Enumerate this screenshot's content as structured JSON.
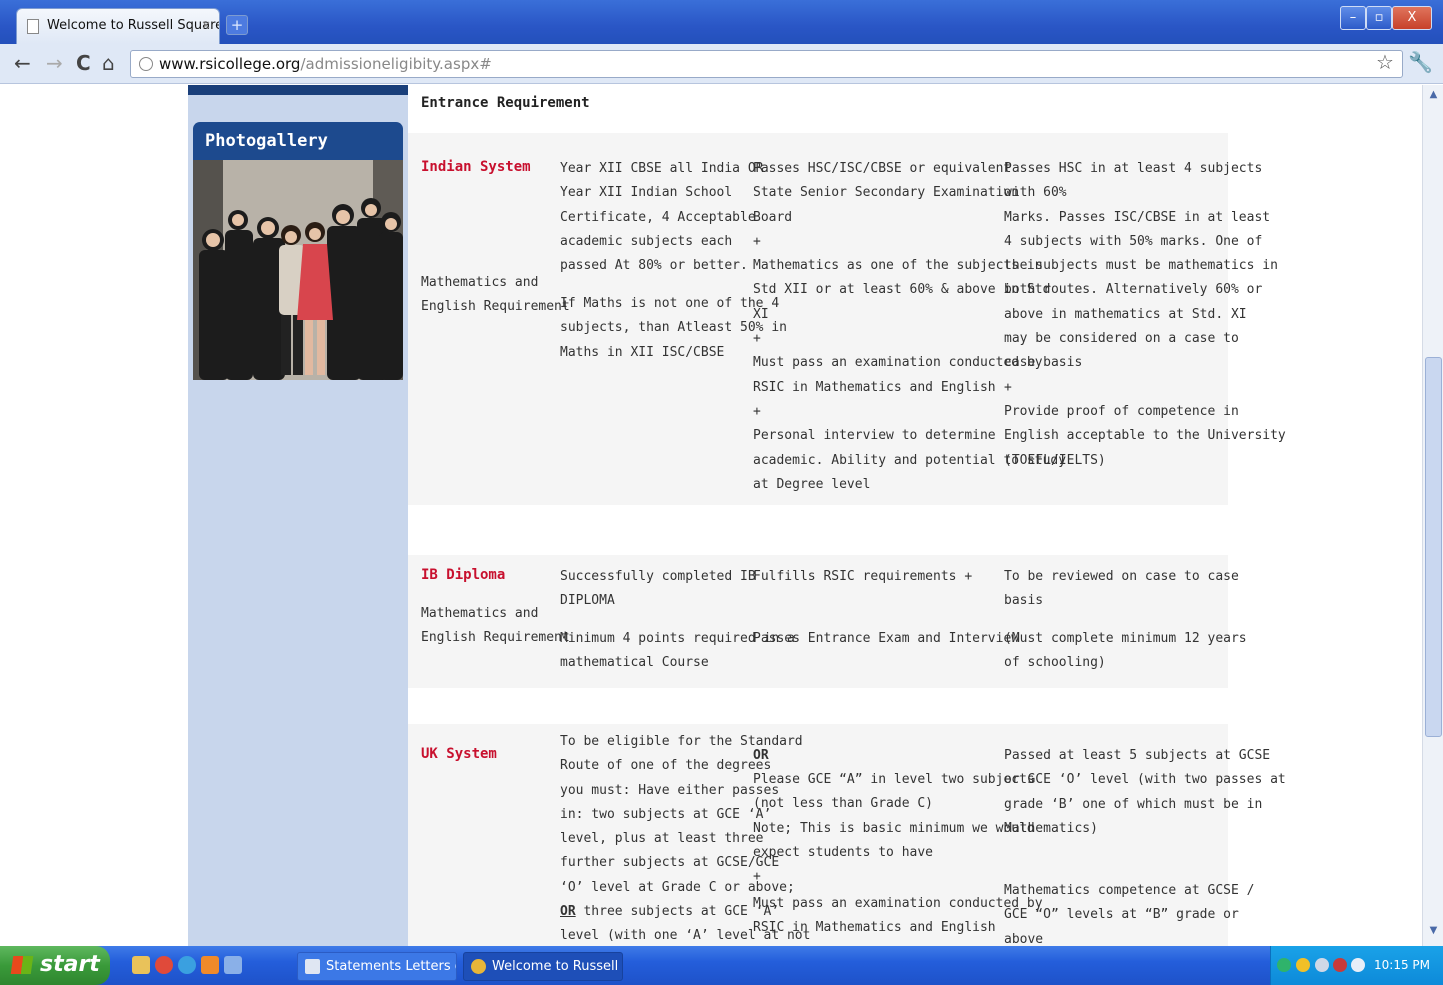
{
  "browser": {
    "tab_title": "Welcome to Russell Square...",
    "tab_close": "×",
    "new_tab": "+",
    "url_domain": "www.rsicollege.org",
    "url_path": "/admissioneligibity.aspx#",
    "window_buttons": {
      "minimize": "–",
      "maximize": "▫",
      "close": "X"
    }
  },
  "sidebar": {
    "photogallery_title": "Photogallery"
  },
  "page": {
    "heading": "Entrance Requirement",
    "rows": [
      {
        "system": "Indian System",
        "sub_label": "Mathematics and\nEnglish Requirement",
        "col1a": "Year XII CBSE all India OR\nYear XII Indian School\nCertificate, 4 Acceptable\nacademic subjects each\npassed At 80% or better.",
        "col1b": "If Maths is not one of the 4\nsubjects, than Atleast 50% in\nMaths in XII ISC/CBSE",
        "col2": "Passes HSC/ISC/CBSE or equivalent\nState Senior Secondary Examination\nBoard\n+\nMathematics as one of the subjects in\nStd XII or at least 60% & above in Std\nXI\n+\nMust pass an examination conducted by\nRSIC in Mathematics and English\n+\nPersonal interview to determine\nacademic. Ability and potential to study\nat Degree level",
        "col3": "Passes HSC in at least 4 subjects\nwith 60%\nMarks. Passes ISC/CBSE in at least\n4 subjects with 50% marks. One of\nthe subjects must be mathematics in\nboth routes. Alternatively 60% or\nabove in mathematics at Std. XI\nmay be considered on a case to\ncase basis\n+\nProvide proof of competence in\nEnglish acceptable to the University\n(TOEFL/IELTS)"
      },
      {
        "system": "IB Diploma",
        "sub_label": "Mathematics and\nEnglish Requirement",
        "col1a": "Successfully completed IB\nDIPLOMA",
        "col1b": "Minimum 4 points required in a\nmathematical Course",
        "col2a": "Fulfills RSIC requirements +",
        "col2b": "Passes Entrance Exam and Interview",
        "col3a": "To be reviewed on case to case\nbasis",
        "col3b": "(Must complete minimum 12 years\nof schooling)"
      },
      {
        "system": "UK System",
        "col1_part1": "To be eligible for the Standard\nRoute of one of the degrees\nyou must: Have either passes\nin: two subjects at GCE ‘A’\nlevel, plus at least three\nfurther subjects at GCSE/GCE\n‘O’ level at Grade C or above;",
        "col1_or": "OR",
        "col1_part2": " three subjects at GCE ‘A’",
        "col1_part3": "level (with one ‘A’ level at not",
        "col2a": "OR",
        "col2b": "Please GCE “A” in level two subjects\n(not less than Grade C)\nNote; This is basic minimum we would\nexpect students to have\n+",
        "col2c": "Must pass an examination conducted by\nRSIC in Mathematics and English",
        "col3a": "Passed at least 5 subjects at GCSE\nor GCE ‘O’ level (with two passes at\ngrade ‘B’ one of which must be in\nMathematics)",
        "col3b": "Mathematics competence at GCSE /\nGCE “O” levels at “B” grade or\nabove"
      }
    ]
  },
  "taskbar": {
    "start_label": "start",
    "items": [
      {
        "label": "Statements Letters o..."
      },
      {
        "label": "Welcome to Russell S..."
      }
    ],
    "clock": "10:15 PM"
  },
  "colors": {
    "accent_red": "#c8102e",
    "sidebar_blue": "#1d4a8e",
    "taskbar_blue": "#245edb",
    "start_green": "#3a9a3a"
  },
  "icons": [
    "page-icon",
    "back-icon",
    "forward-icon",
    "reload-icon",
    "home-icon",
    "globe-icon",
    "star-icon",
    "wrench-icon",
    "windows-flag-icon"
  ]
}
